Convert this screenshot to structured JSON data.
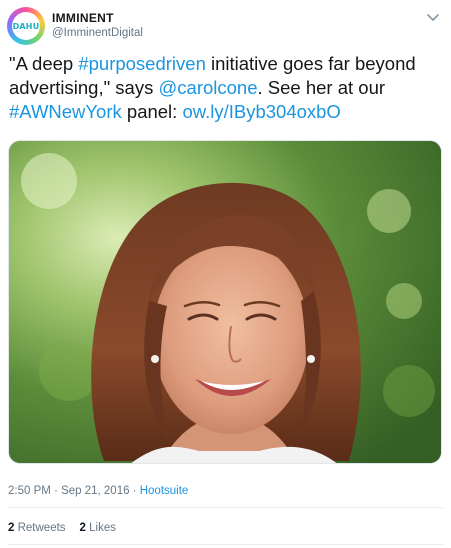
{
  "author": {
    "name": "IMMINENT",
    "handle": "@ImminentDigital",
    "avatar_text": "DAHU"
  },
  "tweet": {
    "t1": "\"A deep ",
    "hashtag1": "#purposedriven",
    "t2": " initiative goes far beyond advertising,\" says ",
    "mention": "@carolcone",
    "t3": ". See her at our ",
    "hashtag2": "#AWNewYork",
    "t4": " panel: ",
    "url": "ow.ly/IByb304oxbO"
  },
  "meta": {
    "time": "2:50 PM",
    "sep1": " · ",
    "date": "Sep 21, 2016",
    "sep2": " · ",
    "source": "Hootsuite"
  },
  "stats": {
    "retweets_count": "2",
    "retweets_label": "Retweets",
    "likes_count": "2",
    "likes_label": "Likes"
  },
  "colors": {
    "link": "#1b95e0",
    "muted": "#657786",
    "text": "#14171a"
  },
  "icons": {
    "menu": "chevron-down-icon",
    "avatar": "profile-avatar"
  }
}
